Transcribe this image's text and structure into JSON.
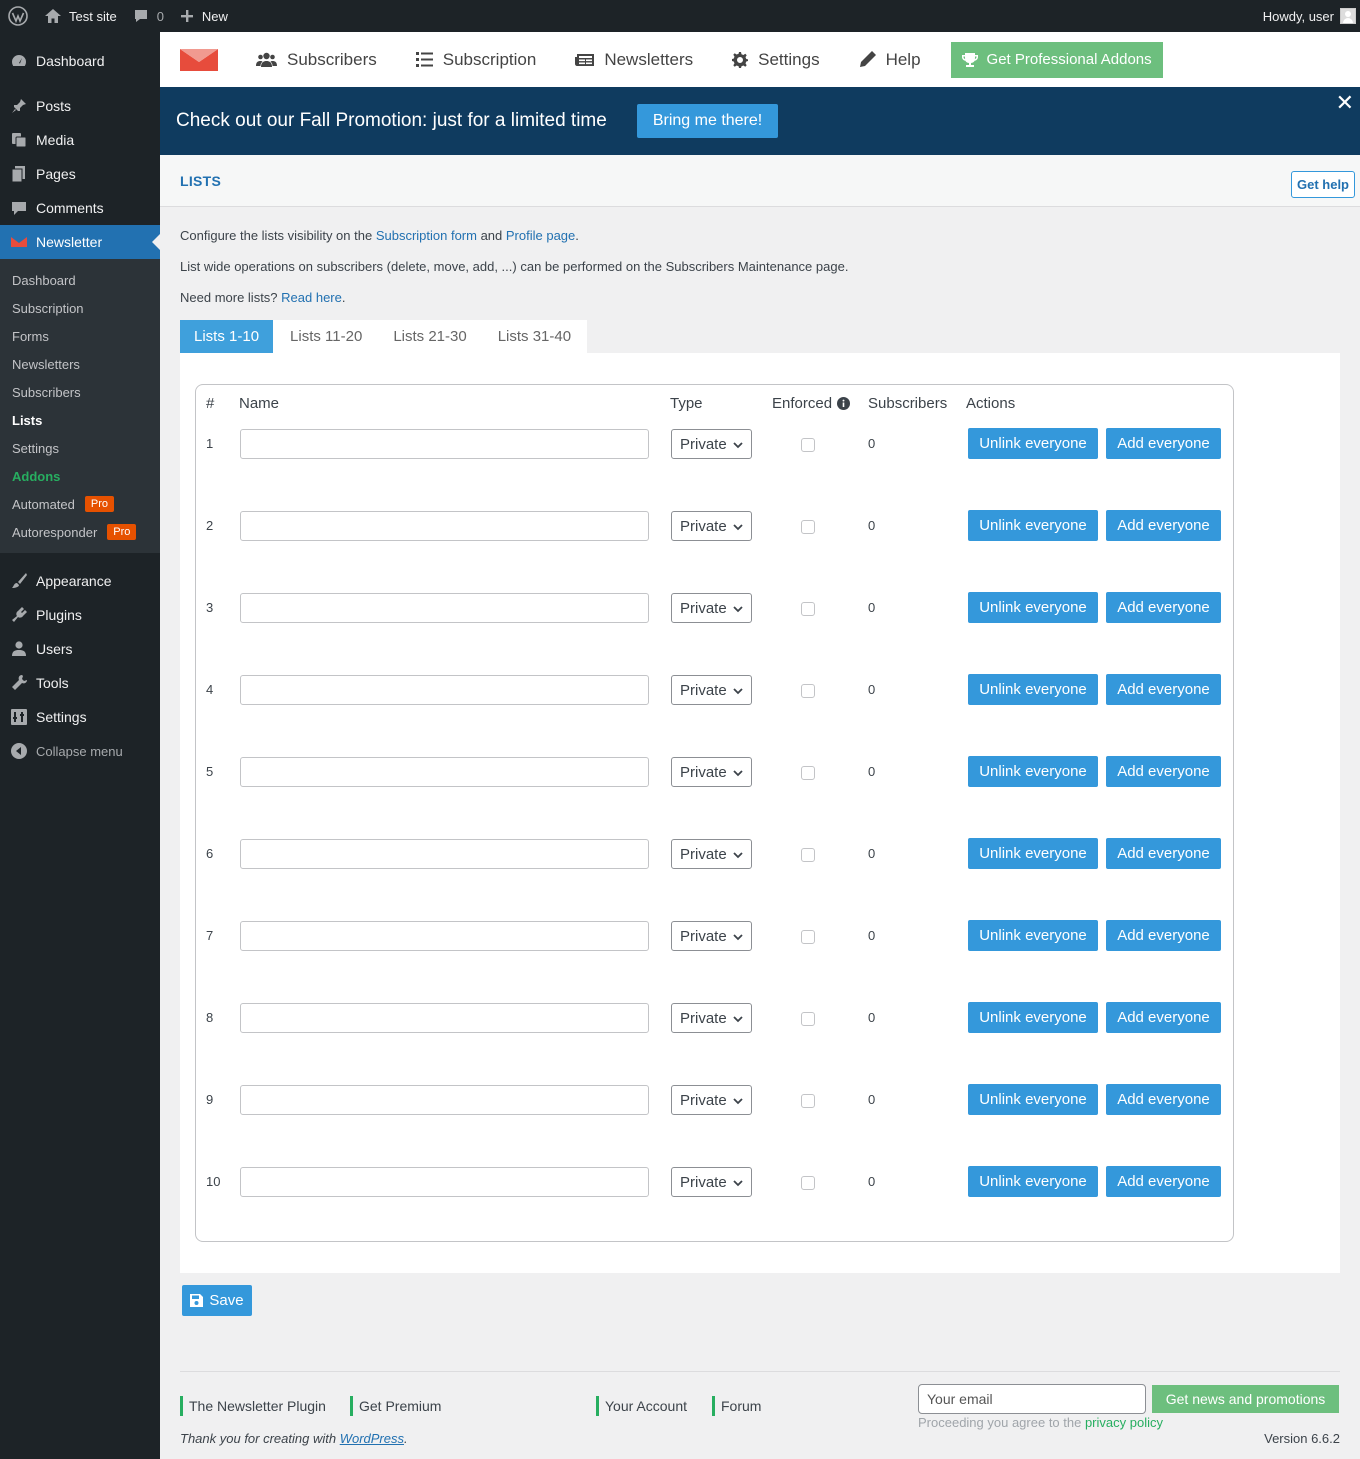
{
  "adminbar": {
    "site_name": "Test site",
    "comments_count": "0",
    "new_label": "New",
    "howdy": "Howdy, user"
  },
  "menu": {
    "top": [
      {
        "label": "Dashboard",
        "icon": "dashboard-icon"
      },
      {
        "label": "Posts",
        "icon": "pin-icon"
      },
      {
        "label": "Media",
        "icon": "media-icon"
      },
      {
        "label": "Pages",
        "icon": "pages-icon"
      },
      {
        "label": "Comments",
        "icon": "comment-icon"
      },
      {
        "label": "Newsletter",
        "icon": "newsletter-icon"
      }
    ],
    "submenu": [
      "Dashboard",
      "Subscription",
      "Forms",
      "Newsletters",
      "Subscribers",
      "Lists",
      "Settings",
      "Addons",
      "Automated",
      "Autoresponder"
    ],
    "pro_badge": "Pro",
    "bottom": [
      {
        "label": "Appearance",
        "icon": "brush-icon"
      },
      {
        "label": "Plugins",
        "icon": "plugin-icon"
      },
      {
        "label": "Users",
        "icon": "user-icon"
      },
      {
        "label": "Tools",
        "icon": "wrench-icon"
      },
      {
        "label": "Settings",
        "icon": "settings-icon"
      }
    ],
    "collapse": "Collapse menu"
  },
  "nav": {
    "subscribers": "Subscribers",
    "subscription": "Subscription",
    "newsletters": "Newsletters",
    "settings": "Settings",
    "help": "Help",
    "pro": "Get Professional Addons"
  },
  "promo": {
    "text": "Check out our Fall Promotion: just for a limited time",
    "button": "Bring me there!",
    "close": "✕"
  },
  "page": {
    "title": "LISTS",
    "help_button": "Get help"
  },
  "intro": {
    "line1_a": "Configure the lists visibility on the ",
    "line1_link1": "Subscription form",
    "line1_b": " and ",
    "line1_link2": "Profile page",
    "line1_c": ".",
    "line2": "List wide operations on subscribers (delete, move, add, ...) can be performed on the Subscribers Maintenance page.",
    "line3_a": "Need more lists? ",
    "line3_link": "Read here",
    "line3_b": "."
  },
  "tabs": [
    "Lists 1-10",
    "Lists 11-20",
    "Lists 21-30",
    "Lists 31-40"
  ],
  "table": {
    "headers": {
      "num": "#",
      "name": "Name",
      "type": "Type",
      "enforced": "Enforced",
      "subscribers": "Subscribers",
      "actions": "Actions"
    },
    "rows": [
      {
        "num": "1",
        "name": "",
        "type": "Private",
        "enforced": false,
        "subscribers": "0"
      },
      {
        "num": "2",
        "name": "",
        "type": "Private",
        "enforced": false,
        "subscribers": "0"
      },
      {
        "num": "3",
        "name": "",
        "type": "Private",
        "enforced": false,
        "subscribers": "0"
      },
      {
        "num": "4",
        "name": "",
        "type": "Private",
        "enforced": false,
        "subscribers": "0"
      },
      {
        "num": "5",
        "name": "",
        "type": "Private",
        "enforced": false,
        "subscribers": "0"
      },
      {
        "num": "6",
        "name": "",
        "type": "Private",
        "enforced": false,
        "subscribers": "0"
      },
      {
        "num": "7",
        "name": "",
        "type": "Private",
        "enforced": false,
        "subscribers": "0"
      },
      {
        "num": "8",
        "name": "",
        "type": "Private",
        "enforced": false,
        "subscribers": "0"
      },
      {
        "num": "9",
        "name": "",
        "type": "Private",
        "enforced": false,
        "subscribers": "0"
      },
      {
        "num": "10",
        "name": "",
        "type": "Private",
        "enforced": false,
        "subscribers": "0"
      }
    ],
    "unlink_label": "Unlink everyone",
    "add_label": "Add everyone"
  },
  "save_label": "Save",
  "footer": {
    "links": [
      "The Newsletter Plugin",
      "Get Premium",
      "Your Account",
      "Forum"
    ],
    "email_placeholder": "Your email",
    "news_button": "Get news and promotions",
    "consent_a": "Proceeding you agree to the ",
    "consent_link": "privacy policy",
    "thanks_a": "Thank you for creating with ",
    "thanks_link": "WordPress",
    "thanks_b": ".",
    "version": "Version 6.6.2"
  },
  "colors": {
    "accent": "#3498db",
    "promo_bg": "#0f3b5f",
    "green": "#6dbf7e",
    "admin_dark": "#1d2327",
    "menu_current": "#2271b1"
  }
}
